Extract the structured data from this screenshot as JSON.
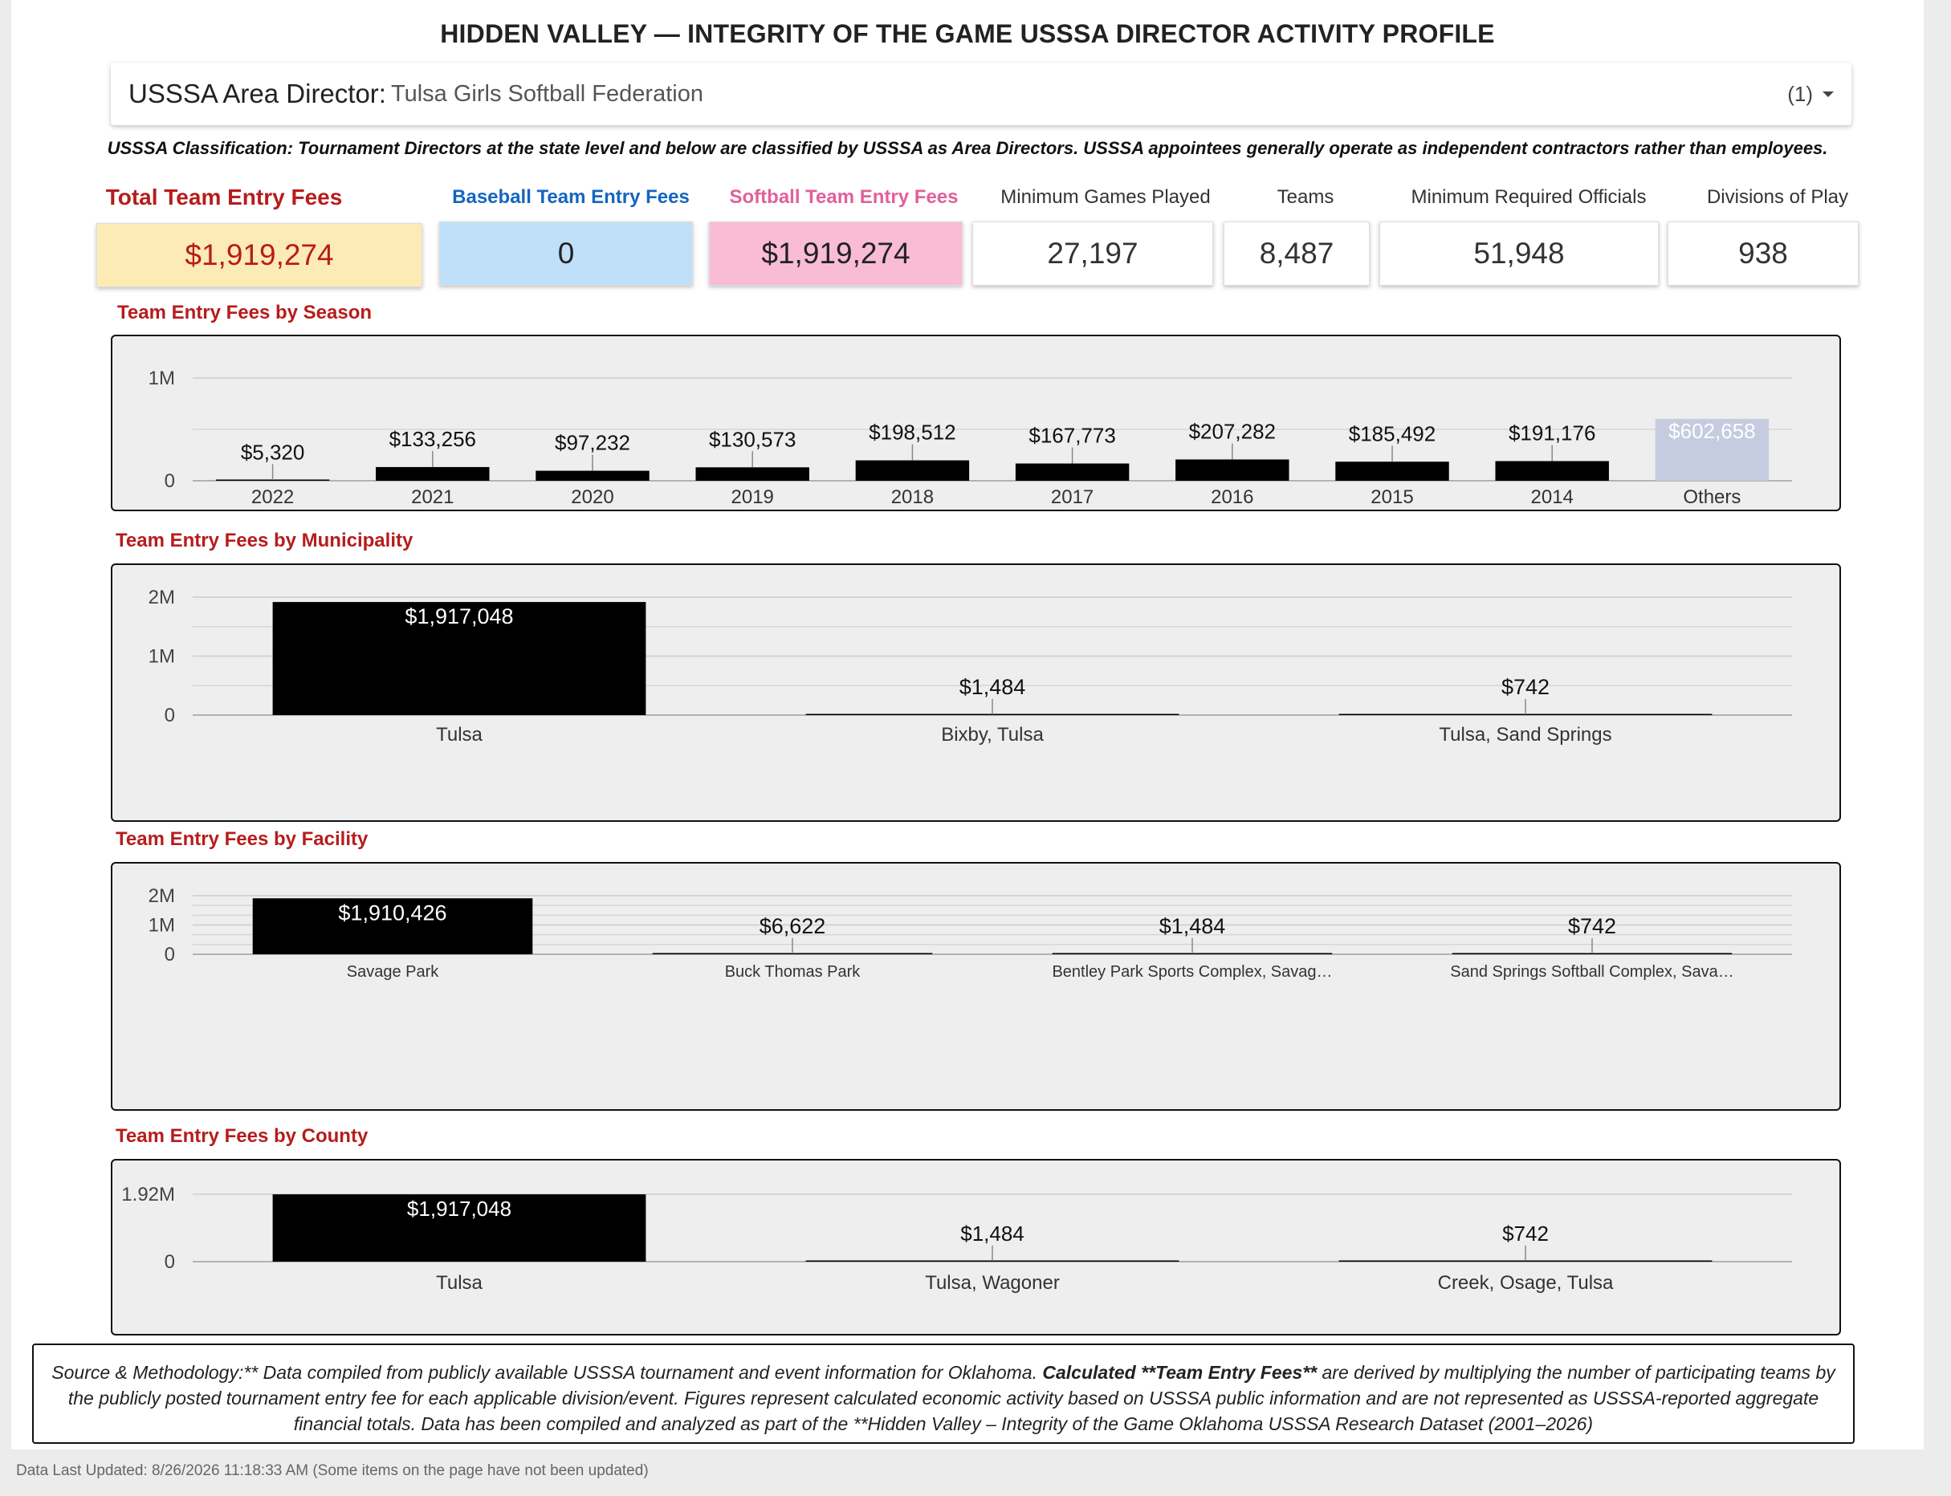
{
  "header": {
    "title": "HIDDEN VALLEY — INTEGRITY OF THE GAME USSSA DIRECTOR ACTIVITY PROFILE"
  },
  "selector": {
    "label": "USSSA Area Director",
    "value": "Tulsa Girls Softball Federation",
    "count": "(1)"
  },
  "classification_note": "USSSA Classification: Tournament Directors at the state level and below are classified by USSSA as Area Directors. USSSA appointees generally operate as independent contractors rather than employees.",
  "kpis": [
    {
      "label": "Total Team Entry Fees",
      "value": "$1,919,274",
      "label_color": "#b71c1c",
      "bg": "#fdebb6",
      "value_color": "#b71c1c"
    },
    {
      "label": "Baseball Team Entry Fees",
      "value": "0",
      "label_color": "#1565c0",
      "bg": "#bfe0f8",
      "value_color": "#222222"
    },
    {
      "label": "Softball Team Entry Fees",
      "value": "$1,919,274",
      "label_color": "#e0609a",
      "bg": "#f9bcd4",
      "value_color": "#222222"
    },
    {
      "label": "Minimum Games Played",
      "value": "27,197",
      "label_color": "#333333",
      "bg": "#ffffff",
      "value_color": "#333333"
    },
    {
      "label": "Teams",
      "value": "8,487",
      "label_color": "#333333",
      "bg": "#ffffff",
      "value_color": "#333333"
    },
    {
      "label": "Minimum Required Officials",
      "value": "51,948",
      "label_color": "#333333",
      "bg": "#ffffff",
      "value_color": "#333333"
    },
    {
      "label": "Divisions of Play",
      "value": "938",
      "label_color": "#333333",
      "bg": "#ffffff",
      "value_color": "#333333"
    }
  ],
  "sections": {
    "season": "Team Entry Fees by Season",
    "municipality": "Team Entry Fees by Municipality",
    "facility": "Team Entry Fees by Facility",
    "county": "Team Entry Fees by County"
  },
  "chart_data": [
    {
      "id": "season",
      "type": "bar",
      "title": "Team Entry Fees by Season",
      "categories": [
        "2022",
        "2021",
        "2020",
        "2019",
        "2018",
        "2017",
        "2016",
        "2015",
        "2014",
        "Others"
      ],
      "values": [
        5320,
        133256,
        97232,
        130573,
        198512,
        167773,
        207282,
        185492,
        191176,
        602658
      ],
      "labels": [
        "$5,320",
        "$133,256",
        "$97,232",
        "$130,573",
        "$198,512",
        "$167,773",
        "$207,282",
        "$185,492",
        "$191,176",
        "$602,658"
      ],
      "ylim": [
        0,
        1000000
      ],
      "yticks": [
        {
          "v": 0,
          "t": "0"
        },
        {
          "v": 1000000,
          "t": "1M"
        }
      ],
      "grid": true,
      "bar_color": "#000000",
      "others_color": "#c5cce0"
    },
    {
      "id": "municipality",
      "type": "bar",
      "title": "Team Entry Fees by Municipality",
      "categories": [
        "Tulsa",
        "Bixby, Tulsa",
        "Tulsa, Sand Springs"
      ],
      "values": [
        1917048,
        1484,
        742
      ],
      "labels": [
        "$1,917,048",
        "$1,484",
        "$742"
      ],
      "ylim": [
        0,
        2000000
      ],
      "yticks": [
        {
          "v": 0,
          "t": "0"
        },
        {
          "v": 1000000,
          "t": "1M"
        },
        {
          "v": 2000000,
          "t": "2M"
        }
      ],
      "grid": true,
      "bar_color": "#000000"
    },
    {
      "id": "facility",
      "type": "bar",
      "title": "Team Entry Fees by Facility",
      "categories": [
        "Savage Park",
        "Buck Thomas Park",
        "Bentley Park Sports Complex, Savag…",
        "Sand Springs Softball Complex, Sava…"
      ],
      "values": [
        1910426,
        6622,
        1484,
        742
      ],
      "labels": [
        "$1,910,426",
        "$6,622",
        "$1,484",
        "$742"
      ],
      "ylim": [
        0,
        2000000
      ],
      "yticks": [
        {
          "v": 0,
          "t": "0"
        },
        {
          "v": 1000000,
          "t": "1M"
        },
        {
          "v": 2000000,
          "t": "2M"
        }
      ],
      "grid": true,
      "bar_color": "#000000"
    },
    {
      "id": "county",
      "type": "bar",
      "title": "Team Entry Fees by County",
      "categories": [
        "Tulsa",
        "Tulsa, Wagoner",
        "Creek, Osage, Tulsa"
      ],
      "values": [
        1917048,
        1484,
        742
      ],
      "labels": [
        "$1,917,048",
        "$1,484",
        "$742"
      ],
      "ylim": [
        0,
        1920000
      ],
      "yticks": [
        {
          "v": 0,
          "t": "0"
        },
        {
          "v": 1920000,
          "t": "1.92M"
        }
      ],
      "grid": true,
      "bar_color": "#000000"
    }
  ],
  "footer": {
    "part1": "Source & Methodology:** Data compiled from publicly available USSSA tournament and event information for Oklahoma. ",
    "bold": "Calculated **Team Entry Fees**",
    "part2": " are derived by multiplying the number of participating teams by the publicly posted tournament entry fee for each applicable division/event. Figures represent calculated economic activity based on USSSA public information and are not represented as USSSA-reported aggregate financial totals. Data has been compiled and analyzed as part of the **Hidden Valley – Integrity of the Game Oklahoma USSSA Research Dataset (2001–2026)"
  },
  "updated": "Data Last Updated: 8/26/2026 11:18:33 AM (Some items on the page have not been updated)"
}
